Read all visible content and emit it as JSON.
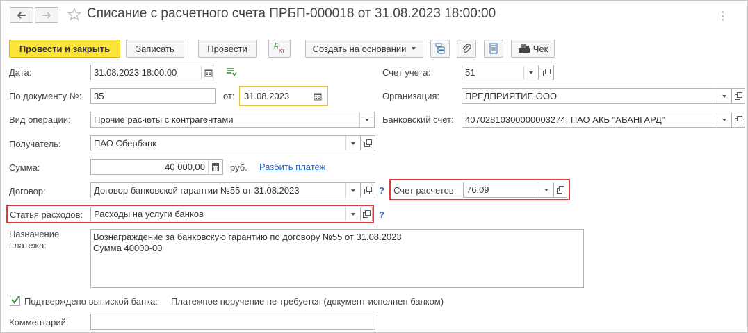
{
  "title": "Списание с расчетного счета ПРБП-000018 от 31.08.2023 18:00:00",
  "toolbar": {
    "post_close": "Провести и закрыть",
    "save": "Записать",
    "post": "Провести",
    "dtkt_top": "Дт",
    "dtkt_bottom": "Кт",
    "create_based": "Создать на основании",
    "receipt": "Чек"
  },
  "form": {
    "date_label": "Дата:",
    "date_value": "31.08.2023 18:00:00",
    "doc_no_label": "По документу №:",
    "doc_no_value": "35",
    "from_label": "от:",
    "from_value": "31.08.2023",
    "op_type_label": "Вид операции:",
    "op_type_value": "Прочие расчеты с контрагентами",
    "recipient_label": "Получатель:",
    "recipient_value": "ПАО Сбербанк",
    "sum_label": "Сумма:",
    "sum_value": "40 000,00",
    "currency": "руб.",
    "split_link": "Разбить платеж",
    "contract_label": "Договор:",
    "contract_value": "Договор банковской гарантии №55 от 31.08.2023",
    "expense_label": "Статья расходов:",
    "expense_value": "Расходы на услуги банков",
    "purpose_label": "Назначение платежа:",
    "purpose_line1": "Вознаграждение за банковскую гарантию по договору №55 от 31.08.2023",
    "purpose_line2": "Сумма 40000-00",
    "confirmed_label": "Подтверждено выпиской банка:",
    "confirmed_checked": true,
    "payment_order_note": "Платежное поручение не требуется (документ исполнен банком)",
    "comment_label": "Комментарий:",
    "comment_value": "",
    "help": "?"
  },
  "right": {
    "account_label": "Счет учета:",
    "account_value": "51",
    "org_label": "Организация:",
    "org_value": "ПРЕДПРИЯТИЕ ООО",
    "bank_account_label": "Банковский счет:",
    "bank_account_value": "40702810300000003274, ПАО АКБ \"АВАНГАРД\"",
    "settlement_label": "Счет расчетов:",
    "settlement_value": "76.09"
  },
  "colors": {
    "primary_button": "#fbe337",
    "highlight_red": "#e23a3a",
    "link": "#2a62b8"
  }
}
